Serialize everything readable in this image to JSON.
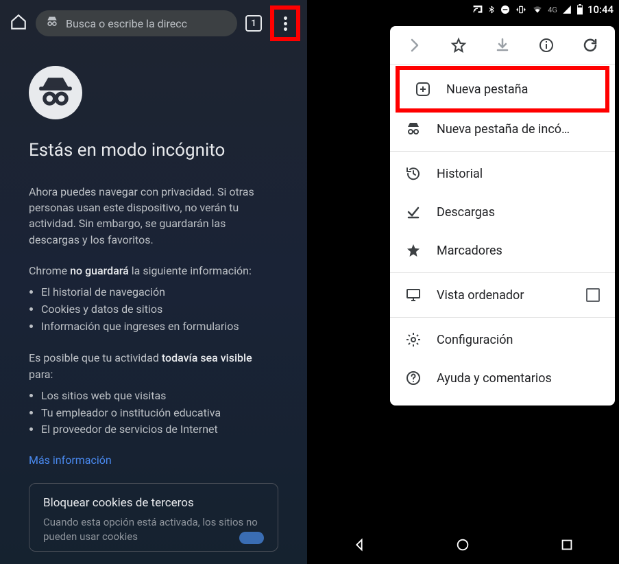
{
  "left": {
    "omnibox_placeholder": "Busca o escribe la direcc",
    "tab_count": "1",
    "title": "Estás en modo incógnito",
    "p1_a": "Ahora puedes navegar con privacidad. Si otras personas usan este dispositivo, no verán tu actividad. Sin embargo, se guardarán las descargas y los favoritos.",
    "p2_a": "Chrome ",
    "p2_b": "no guardará",
    "p2_c": " la siguiente información:",
    "list1": [
      "El historial de navegación",
      "Cookies y datos de sitios",
      "Información que ingreses en formularios"
    ],
    "p3_a": "Es posible que tu actividad ",
    "p3_b": "todavía sea visible",
    "p3_c": " para:",
    "list2": [
      "Los sitios web que visitas",
      "Tu empleador o institución educativa",
      "El proveedor de servicios de Internet"
    ],
    "learn_more": "Más información",
    "cookie_title": "Bloquear cookies de terceros",
    "cookie_sub": "Cuando esta opción está activada, los sitios no pueden usar cookies"
  },
  "right": {
    "status": {
      "net": "4G",
      "time": "10:44"
    },
    "menu": {
      "new_tab": "Nueva pestaña",
      "new_incognito": "Nueva pestaña de incó…",
      "history": "Historial",
      "downloads": "Descargas",
      "bookmarks": "Marcadores",
      "desktop": "Vista ordenador",
      "settings": "Configuración",
      "help": "Ayuda y comentarios"
    }
  }
}
